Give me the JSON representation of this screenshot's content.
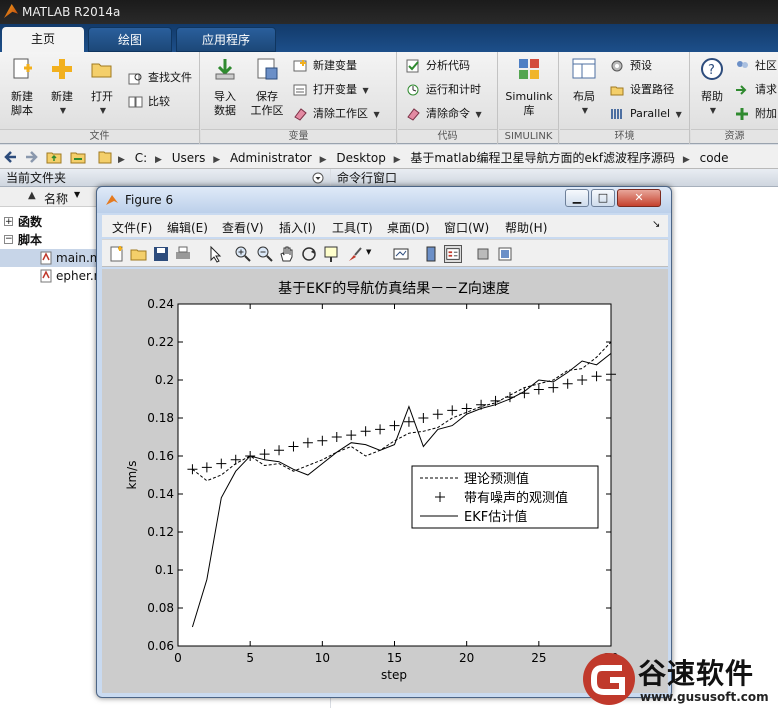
{
  "app": {
    "title": "MATLAB R2014a"
  },
  "tabs": [
    {
      "label": "主页"
    },
    {
      "label": "绘图"
    },
    {
      "label": "应用程序"
    }
  ],
  "ribbon": {
    "file_group": {
      "label": "文件",
      "new_script": "新建\n脚本",
      "new": "新建",
      "open": "打开",
      "find_files": "查找文件",
      "compare": "比较"
    },
    "variable_group": {
      "label": "变量",
      "import": "导入\n数据",
      "save_workspace": "保存\n工作区",
      "new_variable": "新建变量",
      "open_variable": "打开变量",
      "clear_workspace": "清除工作区"
    },
    "code_group": {
      "label": "代码",
      "analyze": "分析代码",
      "run_time": "运行和计时",
      "clear_commands": "清除命令"
    },
    "simulink_group": {
      "label": "SIMULINK",
      "library": "Simulink\n库"
    },
    "env_group": {
      "label": "环境",
      "layout": "布局",
      "preferences": "预设",
      "set_path": "设置路径",
      "parallel": "Parallel"
    },
    "resources_group": {
      "label": "资源",
      "help": "帮助",
      "community": "社区",
      "request": "请求",
      "addons": "附加"
    }
  },
  "address": {
    "crumbs": [
      "C:",
      "Users",
      "Administrator",
      "Desktop",
      "基于matlab编程卫星导航方面的ekf滤波程序源码",
      "code"
    ]
  },
  "left_panel": {
    "header": "当前文件夹",
    "column": "名称",
    "sort_indicator": "▲",
    "rows": [
      {
        "label": "函数",
        "kind": "group"
      },
      {
        "label": "脚本",
        "kind": "group"
      },
      {
        "label": "main.m",
        "kind": "file"
      },
      {
        "label": "epher.m",
        "kind": "file"
      }
    ]
  },
  "right_panel": {
    "header": "命令行窗口"
  },
  "figure": {
    "title": "Figure 6",
    "menu": [
      "文件(F)",
      "编辑(E)",
      "查看(V)",
      "插入(I)",
      "工具(T)",
      "桌面(D)",
      "窗口(W)",
      "帮助(H)"
    ],
    "menu_arrow": "↘"
  },
  "chart_data": {
    "type": "line",
    "title": "基于EKF的导航仿真结果－－Z向速度",
    "xlabel": "step",
    "ylabel": "km/s",
    "xlim": [
      0,
      30
    ],
    "ylim": [
      0.06,
      0.24
    ],
    "xticks": [
      0,
      5,
      10,
      15,
      20,
      25,
      30
    ],
    "yticks": [
      0.06,
      0.08,
      0.1,
      0.12,
      0.14,
      0.16,
      0.18,
      0.2,
      0.22,
      0.24
    ],
    "ytick_labels": [
      "0.06",
      "0.08",
      "0.1",
      "0.12",
      "0.14",
      "0.16",
      "0.18",
      "0.2",
      "0.22",
      "0.24"
    ],
    "legend_position": "center-right",
    "series": [
      {
        "name": "理论预测值",
        "style": "dashed",
        "x": [
          1,
          2,
          3,
          4,
          5,
          6,
          7,
          8,
          9,
          10,
          11,
          12,
          13,
          14,
          15,
          16,
          17,
          18,
          19,
          20,
          21,
          22,
          23,
          24,
          25,
          26,
          27,
          28,
          29,
          30
        ],
        "values": [
          0.153,
          0.147,
          0.15,
          0.156,
          0.16,
          0.155,
          0.156,
          0.152,
          0.155,
          0.158,
          0.162,
          0.165,
          0.16,
          0.163,
          0.168,
          0.172,
          0.173,
          0.175,
          0.18,
          0.183,
          0.186,
          0.188,
          0.192,
          0.196,
          0.198,
          0.2,
          0.205,
          0.206,
          0.212,
          0.22
        ]
      },
      {
        "name": "带有噪声的观测值",
        "style": "plus",
        "x": [
          1,
          2,
          3,
          4,
          5,
          6,
          7,
          8,
          9,
          10,
          11,
          12,
          13,
          14,
          15,
          16,
          17,
          18,
          19,
          20,
          21,
          22,
          23,
          24,
          25,
          26,
          27,
          28,
          29,
          30
        ],
        "values": [
          0.153,
          0.154,
          0.156,
          0.158,
          0.16,
          0.161,
          0.163,
          0.165,
          0.167,
          0.168,
          0.17,
          0.171,
          0.173,
          0.174,
          0.176,
          0.178,
          0.18,
          0.182,
          0.184,
          0.185,
          0.187,
          0.189,
          0.191,
          0.193,
          0.195,
          0.196,
          0.198,
          0.2,
          0.202,
          0.203
        ]
      },
      {
        "name": "EKF估计值",
        "style": "solid",
        "x": [
          1,
          2,
          3,
          4,
          5,
          6,
          7,
          8,
          9,
          10,
          11,
          12,
          13,
          14,
          15,
          16,
          17,
          18,
          19,
          20,
          21,
          22,
          23,
          24,
          25,
          26,
          27,
          28,
          29,
          30
        ],
        "values": [
          0.07,
          0.095,
          0.138,
          0.152,
          0.16,
          0.158,
          0.157,
          0.153,
          0.15,
          0.156,
          0.162,
          0.167,
          0.166,
          0.163,
          0.166,
          0.186,
          0.165,
          0.174,
          0.176,
          0.182,
          0.185,
          0.187,
          0.19,
          0.194,
          0.2,
          0.199,
          0.204,
          0.21,
          0.208,
          0.214
        ]
      }
    ]
  },
  "watermark": {
    "brand": "谷速软件",
    "url": "www.gususoft.com"
  },
  "colors": {
    "tab_bg": "#1d4f8a",
    "fig_frame": "#c9daf0",
    "plot_bg": "#ffffff",
    "axes_bg": "#cccccc"
  }
}
